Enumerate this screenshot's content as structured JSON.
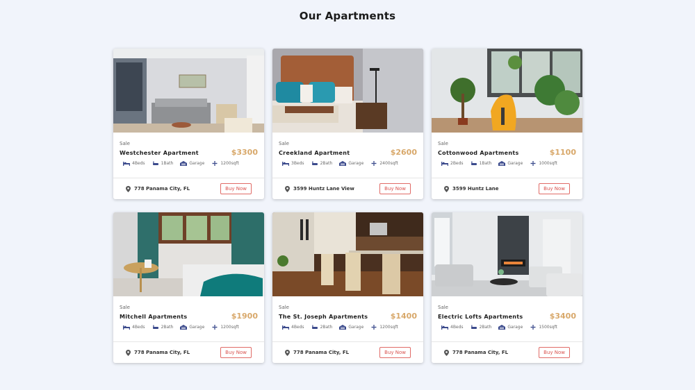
{
  "page": {
    "title": "Our Apartments"
  },
  "colors": {
    "price": "#d8a86a",
    "buy_button": "#d9534f",
    "background": "#f1f4fb"
  },
  "listings": [
    {
      "tag": "Sale",
      "name": "Westchester Apartment",
      "price": "$3300",
      "beds": "4Beds",
      "baths": "1Bath",
      "garage": "Garage",
      "area": "1200sqft",
      "location": "778 Panama City, FL",
      "button": "Buy Now"
    },
    {
      "tag": "Sale",
      "name": "Creekland Apartment",
      "price": "$2600",
      "beds": "3Beds",
      "baths": "2Bath",
      "garage": "Garage",
      "area": "2400sqft",
      "location": "3599 Huntz Lane View",
      "button": "Buy Now"
    },
    {
      "tag": "Sale",
      "name": "Cottonwood Apartments",
      "price": "$1100",
      "beds": "2Beds",
      "baths": "1Bath",
      "garage": "Garage",
      "area": "1000sqft",
      "location": "3599 Huntz Lane",
      "button": "Buy Now"
    },
    {
      "tag": "Sale",
      "name": "Mitchell Apartments",
      "price": "$1900",
      "beds": "4Beds",
      "baths": "2Bath",
      "garage": "Garage",
      "area": "1200sqft",
      "location": "778 Panama City, FL",
      "button": "Buy Now"
    },
    {
      "tag": "Sale",
      "name": "The St. Joseph Apartments",
      "price": "$1400",
      "beds": "4Beds",
      "baths": "2Bath",
      "garage": "Garage",
      "area": "1200sqft",
      "location": "778 Panama City, FL",
      "button": "Buy Now"
    },
    {
      "tag": "Sale",
      "name": "Electric Lofts Apartments",
      "price": "$3400",
      "beds": "4Beds",
      "baths": "2Bath",
      "garage": "Garage",
      "area": "1500sqft",
      "location": "778 Panama City, FL",
      "button": "Buy Now"
    }
  ],
  "icons": {
    "beds": "bed-icon",
    "baths": "bathtub-icon",
    "garage": "garage-icon",
    "area": "area-icon",
    "location": "location-pin-icon"
  }
}
